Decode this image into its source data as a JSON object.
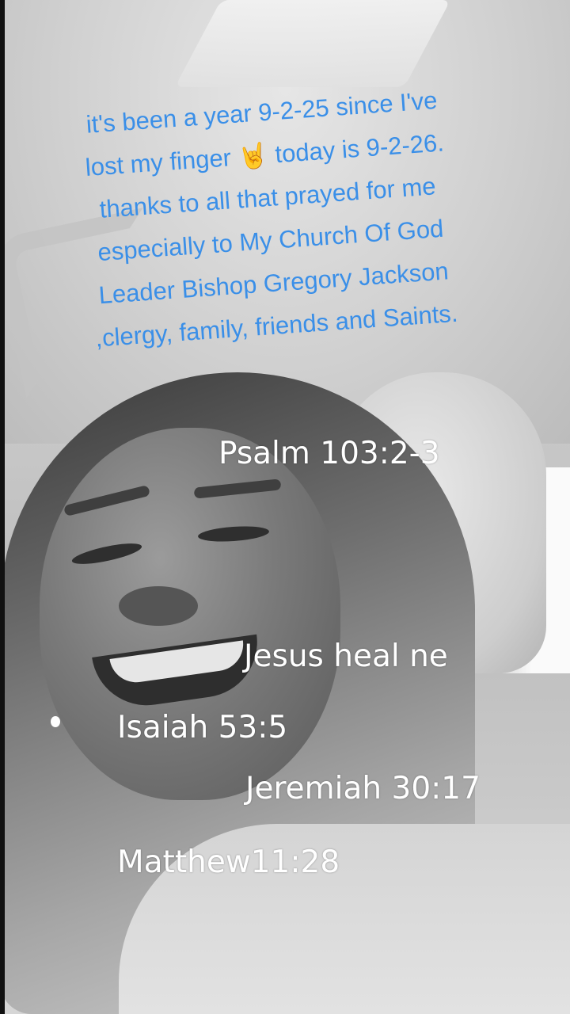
{
  "caption": "it's been a year 9-2-25 since I've lost my finger 🤘 today is 9-2-26. thanks to all that prayed for me especially to My Church Of God Leader Bishop Gregory Jackson  ,clergy, family, friends and Saints.",
  "overlays": {
    "psalm": "Psalm 103:2-3",
    "prayer": "Jesus heal ne",
    "isaiah": "Isaiah 53:5",
    "jeremiah": "Jeremiah 30:17",
    "matthew": "Matthew11:28"
  },
  "colors": {
    "caption_text": "#3a8fe8",
    "overlay_text": "#ffffff",
    "filter": "grayscale"
  }
}
